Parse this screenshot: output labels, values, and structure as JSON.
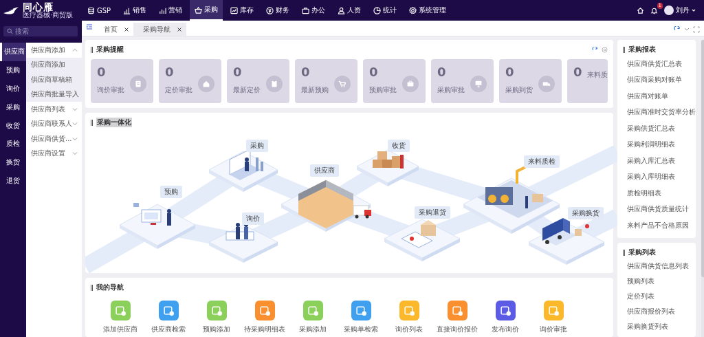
{
  "app": {
    "logo": "同心雁",
    "tagline": "医疗器械·商贸版"
  },
  "top_nav": [
    {
      "label": "GSP",
      "selected": false
    },
    {
      "label": "销售",
      "selected": false
    },
    {
      "label": "营销",
      "selected": false
    },
    {
      "label": "采购",
      "selected": true
    },
    {
      "label": "库存",
      "selected": false
    },
    {
      "label": "财务",
      "selected": false
    },
    {
      "label": "办公",
      "selected": false
    },
    {
      "label": "人资",
      "selected": false
    },
    {
      "label": "统计",
      "selected": false
    },
    {
      "label": "系统管理",
      "selected": false
    }
  ],
  "user": {
    "notification_count": "1",
    "name": "刘丹"
  },
  "search": {
    "placeholder": "搜索"
  },
  "sidebar": {
    "items": [
      {
        "label": "供应商",
        "selected": true
      },
      {
        "label": "预购",
        "selected": false
      },
      {
        "label": "询价",
        "selected": false
      },
      {
        "label": "采购",
        "selected": false
      },
      {
        "label": "收货",
        "selected": false
      },
      {
        "label": "质检",
        "selected": false
      },
      {
        "label": "换货",
        "selected": false
      },
      {
        "label": "退货",
        "selected": false
      }
    ]
  },
  "submenu": {
    "items": [
      {
        "label": "供应商添加",
        "expanded": true,
        "children": [
          {
            "label": "供应商添加"
          },
          {
            "label": "供应商草稿箱"
          },
          {
            "label": "供应商批量导入"
          }
        ]
      },
      {
        "label": "供应商列表",
        "expanded": false
      },
      {
        "label": "供应商联系人",
        "expanded": false
      },
      {
        "label": "供应商供货...",
        "expanded": false
      },
      {
        "label": "供应商设置",
        "expanded": false
      }
    ]
  },
  "tabs": [
    {
      "label": "首页",
      "selected": false
    },
    {
      "label": "采购导航",
      "selected": true
    }
  ],
  "reminders": {
    "title": "采购提醒",
    "cards": [
      {
        "count": "0",
        "label": "询价审批"
      },
      {
        "count": "0",
        "label": "定价审批"
      },
      {
        "count": "0",
        "label": "最新定价"
      },
      {
        "count": "0",
        "label": "最新预购"
      },
      {
        "count": "0",
        "label": "预购审批"
      },
      {
        "count": "0",
        "label": "采购审批"
      },
      {
        "count": "0",
        "label": "采购到货"
      },
      {
        "count": "0",
        "label": "来料质"
      }
    ]
  },
  "flow": {
    "title": "采购一体化",
    "steps": [
      "预购",
      "采购",
      "供应商",
      "询价",
      "收货",
      "采购退货",
      "来料质检",
      "采购换货"
    ]
  },
  "my_nav": {
    "title": "我的导航",
    "items": [
      {
        "label": "添加供应商",
        "color": "#8cd05c"
      },
      {
        "label": "供应商检索",
        "color": "#3fa0ef"
      },
      {
        "label": "预购添加",
        "color": "#8cd05c"
      },
      {
        "label": "待采购明细表",
        "color": "#f98f2e"
      },
      {
        "label": "采购添加",
        "color": "#8cd05c"
      },
      {
        "label": "采购单检索",
        "color": "#3fa0ef"
      },
      {
        "label": "询价列表",
        "color": "#fbb82a"
      },
      {
        "label": "直接询价报价",
        "color": "#f98f2e"
      },
      {
        "label": "发布询价",
        "color": "#5b5be6"
      },
      {
        "label": "询价审批",
        "color": "#fbb82a"
      }
    ]
  },
  "reports": {
    "title": "采购报表",
    "items": [
      "供应商供货汇总表",
      "供应商采购对账单",
      "供应商对账单",
      "供应商准时交货率分析",
      "采购供货汇总表",
      "采购利润明细表",
      "采购入库汇总表",
      "采购入库明细表",
      "质检明细表",
      "供应商供货质量统计",
      "来料产品不合格原因"
    ]
  },
  "lists": {
    "title": "采购列表",
    "items": [
      "供应商供货信息列表",
      "预购列表",
      "定价列表",
      "供应商报价列表",
      "采购换货列表"
    ]
  }
}
